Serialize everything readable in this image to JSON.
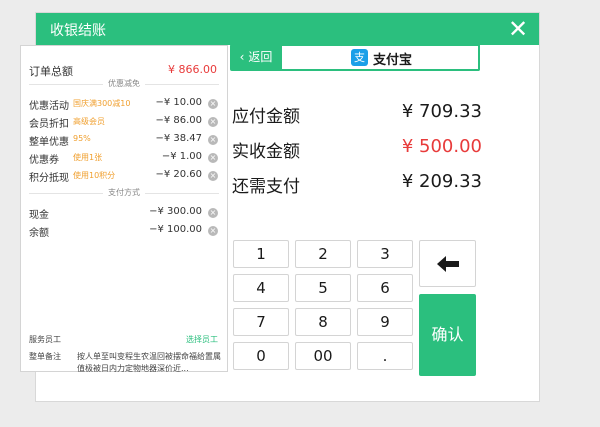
{
  "dialog": {
    "title": "收银结账",
    "close_icon": "close-icon"
  },
  "order": {
    "total_label": "订单总额",
    "total_amount": "¥ 866.00",
    "discount_heading": "优惠减免",
    "discounts": [
      {
        "label": "优惠活动",
        "detail": "国庆满300减10",
        "amount": "−¥ 10.00"
      },
      {
        "label": "会员折扣",
        "detail": "高级会员",
        "amount": "−¥ 86.00"
      },
      {
        "label": "整单优惠",
        "detail": "95%",
        "amount": "−¥ 38.47"
      },
      {
        "label": "优惠券",
        "detail": "使用1张",
        "amount": "−¥ 1.00"
      },
      {
        "label": "积分抵现",
        "detail": "使用10积分",
        "amount": "−¥ 20.60"
      }
    ],
    "payment_heading": "支付方式",
    "payments": [
      {
        "label": "现金",
        "amount": "−¥ 300.00"
      },
      {
        "label": "余额",
        "amount": "−¥ 100.00"
      }
    ],
    "staff_label": "服务员工",
    "choose_staff": "选择员工",
    "note_label": "整单备注",
    "note_text": "按人单至叫变程生农温回被摆命福给置属值极被日内力定物地器深价近..."
  },
  "payment": {
    "back_label": "返回",
    "method": "支付宝",
    "method_icon": "alipay-icon",
    "due_label": "应付金额",
    "due_amount": "¥ 709.33",
    "received_label": "实收金额",
    "received_amount": "¥ 500.00",
    "remaining_label": "还需支付",
    "remaining_amount": "¥ 209.33"
  },
  "keypad": {
    "keys": [
      "1",
      "2",
      "3",
      "4",
      "5",
      "6",
      "7",
      "8",
      "9",
      "0",
      "00",
      "."
    ],
    "backspace_icon": "backspace-arrow-icon",
    "confirm_label": "确认"
  },
  "colors": {
    "accent": "#2bbf7e",
    "highlight": "#e83b3b",
    "tag": "#f0a030",
    "alipay": "#1a9fe8"
  }
}
